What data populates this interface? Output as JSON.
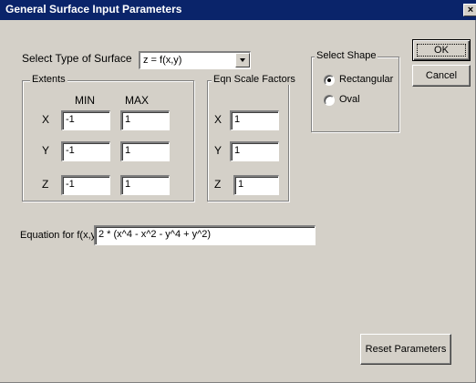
{
  "window": {
    "title": "General Surface Input Parameters",
    "close_glyph": "×"
  },
  "surface_type": {
    "label": "Select Type of Surface",
    "selected": "z = f(x,y)"
  },
  "extents": {
    "title": "Extents",
    "min_header": "MIN",
    "max_header": "MAX",
    "rows": [
      {
        "axis": "X",
        "min": "-1",
        "max": "1"
      },
      {
        "axis": "Y",
        "min": "-1",
        "max": "1"
      },
      {
        "axis": "Z",
        "min": "-1",
        "max": "1"
      }
    ]
  },
  "scale_factors": {
    "title": "Eqn Scale Factors",
    "rows": [
      {
        "axis": "X",
        "value": "1"
      },
      {
        "axis": "Y",
        "value": "1"
      },
      {
        "axis": "Z",
        "value": "1"
      }
    ]
  },
  "shape": {
    "title": "Select Shape",
    "options": [
      {
        "label": "Rectangular",
        "selected": true
      },
      {
        "label": "Oval",
        "selected": false
      }
    ]
  },
  "buttons": {
    "ok": "OK",
    "cancel": "Cancel",
    "reset": "Reset Parameters"
  },
  "equation": {
    "label": "Equation for f(x,y)",
    "value": "2 * (x^4 - x^2 - y^4 + y^2)"
  },
  "colors": {
    "title_bar": "#0a246a",
    "dialog_face": "#d4d0c8"
  }
}
